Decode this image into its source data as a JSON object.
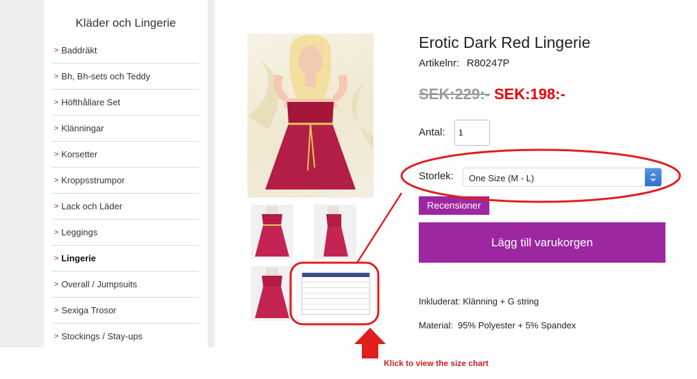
{
  "sidebar": {
    "title": "Kläder och Lingerie",
    "chevron": ">",
    "items": [
      {
        "label": "Baddräkt"
      },
      {
        "label": "Bh, Bh-sets och Teddy"
      },
      {
        "label": "Höfthållare Set"
      },
      {
        "label": "Klänningar"
      },
      {
        "label": "Korsetter"
      },
      {
        "label": "Kroppsstrumpor"
      },
      {
        "label": "Lack och Läder"
      },
      {
        "label": "Leggings"
      },
      {
        "label": "Lingerie"
      },
      {
        "label": "Overall / Jumpsuits"
      },
      {
        "label": "Sexiga Trosor"
      },
      {
        "label": "Stockings / Stay-ups"
      }
    ]
  },
  "product": {
    "title": "Erotic Dark Red Lingerie",
    "article_label": "Artikelnr:",
    "article_number": "R80247P",
    "old_price": "SEK:229:-",
    "new_price": "SEK:198:-",
    "qty_label": "Antal:",
    "qty_value": "1",
    "size_label": "Storlek:",
    "size_value": "One Size (M - L)",
    "reviews_button": "Recensioner",
    "cart_button": "Lägg till varukorgen",
    "included": "Inkluderat: Klänning + G string",
    "material": "Material:  95% Polyester + 5% Spandex"
  },
  "annotation": {
    "text": "Klick to view the size chart"
  },
  "colors": {
    "accent": "#9c27a0",
    "price_red": "#e60000",
    "annotation_red": "#e01e1e"
  }
}
